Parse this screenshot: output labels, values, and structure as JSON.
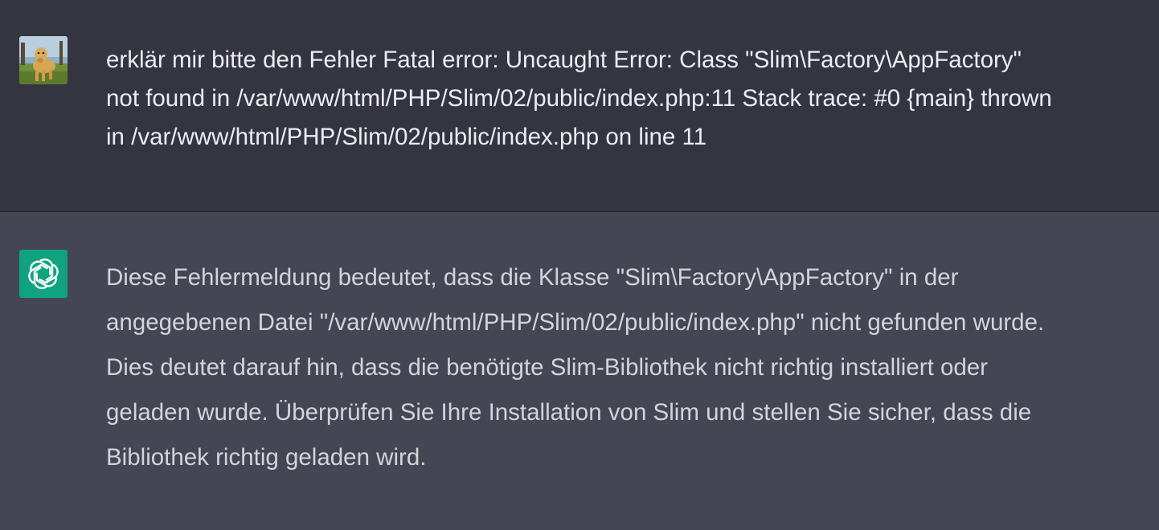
{
  "conversation": {
    "user_message": {
      "avatar": "user-avatar-dog-photo",
      "lines": [
        "erklär mir bitte den Fehler Fatal error: Uncaught Error: Class \"Slim\\Factory\\AppFactory\"",
        "not found in /var/www/html/PHP/Slim/02/public/index.php:11 Stack trace: #0 {main} thrown",
        "in /var/www/html/PHP/Slim/02/public/index.php on line 11"
      ]
    },
    "assistant_message": {
      "avatar": "openai-logo-icon",
      "accent_color": "#10a37f",
      "lines": [
        "Diese Fehlermeldung bedeutet, dass die Klasse \"Slim\\Factory\\AppFactory\" in der",
        "angegebenen Datei \"/var/www/html/PHP/Slim/02/public/index.php\" nicht gefunden wurde.",
        "Dies deutet darauf hin, dass die benötigte Slim-Bibliothek nicht richtig installiert oder",
        "geladen wurde. Überprüfen Sie Ihre Installation von Slim und stellen Sie sicher, dass die",
        "Bibliothek richtig geladen wird."
      ]
    }
  },
  "colors": {
    "user_bg": "#343541",
    "assistant_bg": "#444654",
    "user_text": "#ececf1",
    "assistant_text": "#d1d5db"
  }
}
